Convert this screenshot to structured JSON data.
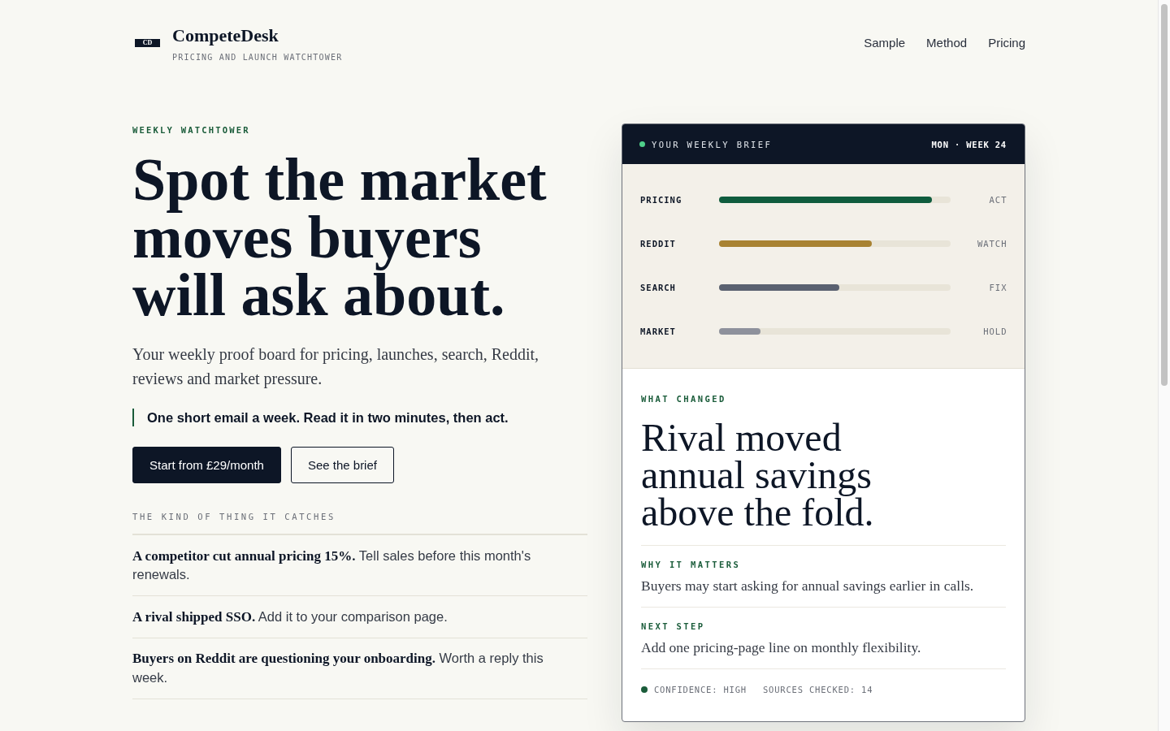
{
  "header": {
    "logo_badge": "CD",
    "brand": "CompeteDesk",
    "tagline": "PRICING AND LAUNCH WATCHTOWER",
    "nav": [
      "Sample",
      "Method",
      "Pricing"
    ]
  },
  "hero": {
    "eyebrow": "WEEKLY WATCHTOWER",
    "headline": "Spot the market moves buyers will ask about.",
    "intro": "Your weekly proof board for pricing, launches, search, Reddit, reviews and market pressure.",
    "callout": "One short email a week. Read it in two minutes, then act.",
    "buttons": [
      {
        "label": "Start from £29/month",
        "kind": "primary"
      },
      {
        "label": "See the brief",
        "kind": "secondary"
      }
    ],
    "examples": {
      "title": "THE KIND OF THING IT CATCHES",
      "items": [
        "**A competitor cut annual pricing 15%.** Tell sales before this month's renewals.",
        "**A rival shipped SSO.** Add it to your comparison page.",
        "**Buyers on Reddit are questioning your onboarding.** Worth a reply this week."
      ]
    }
  },
  "brief": {
    "title": "YOUR WEEKLY BRIEF",
    "date": "MON · WEEK 24",
    "signals": [
      {
        "name": "PRICING",
        "level": 0.92,
        "color": "#0f5c3e",
        "status": "ACT"
      },
      {
        "name": "REDDIT",
        "level": 0.66,
        "color": "#a88232",
        "status": "WATCH"
      },
      {
        "name": "SEARCH",
        "level": 0.52,
        "color": "#5a6170",
        "status": "FIX"
      },
      {
        "name": "MARKET",
        "level": 0.18,
        "color": "#8e919c",
        "status": "HOLD"
      }
    ],
    "what_changed": {
      "label": "WHAT CHANGED",
      "headline": "Rival moved annual savings above the fold."
    },
    "sections": [
      {
        "label": "WHY IT MATTERS",
        "text": "Buyers may start asking for annual savings earlier in calls."
      },
      {
        "label": "NEXT STEP",
        "text": "Add one pricing-page line on monthly flexibility."
      }
    ],
    "footer": [
      "CONFIDENCE: HIGH",
      "SOURCES CHECKED: 14"
    ]
  }
}
